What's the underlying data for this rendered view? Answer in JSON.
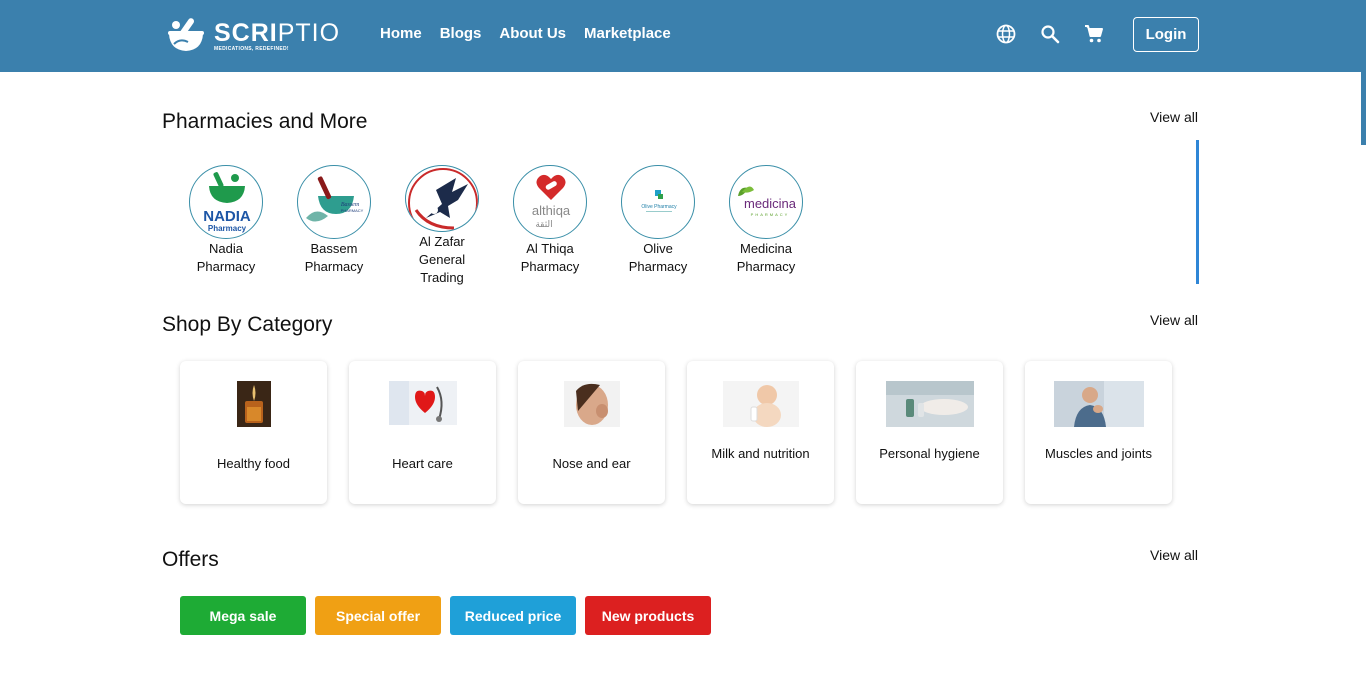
{
  "header": {
    "logo_name_bold": "SCRI",
    "logo_name_thin": "PTIO",
    "logo_tagline": "MEDICATIONS, REDEFINED!",
    "nav": [
      "Home",
      "Blogs",
      "About Us",
      "Marketplace"
    ],
    "login_label": "Login",
    "icons": [
      "globe-icon",
      "search-icon",
      "cart-icon"
    ]
  },
  "pharmacies": {
    "title": "Pharmacies and More",
    "view_all": "View all",
    "items": [
      {
        "name": "Nadia Pharmacy",
        "logo_text": "NADIA",
        "logo_sub": "Pharmacy"
      },
      {
        "name": "Bassem Pharmacy",
        "logo_text": "Bassem",
        "logo_sub": "PHARMACY"
      },
      {
        "name": "Al Zafar General Trading",
        "logo_text": "",
        "logo_sub": ""
      },
      {
        "name": "Al Thiqa Pharmacy",
        "logo_text": "althiqa",
        "logo_sub": "الثقة"
      },
      {
        "name": "Olive Pharmacy",
        "logo_text": "Olive Pharmacy",
        "logo_sub": ""
      },
      {
        "name": "Medicina Pharmacy",
        "logo_text": "medicina",
        "logo_sub": "PHARMACY"
      }
    ]
  },
  "categories": {
    "title": "Shop By Category",
    "view_all": "View all",
    "items": [
      {
        "label": "Healthy food"
      },
      {
        "label": "Heart care"
      },
      {
        "label": "Nose and ear"
      },
      {
        "label": "Milk and nutrition"
      },
      {
        "label": "Personal hygiene"
      },
      {
        "label": "Muscles and joints"
      }
    ]
  },
  "offers": {
    "title": "Offers",
    "view_all": "View all",
    "items": [
      {
        "label": "Mega sale",
        "color": "#1eab35"
      },
      {
        "label": "Special offer",
        "color": "#f0a014"
      },
      {
        "label": "Reduced price",
        "color": "#1fa0d8"
      },
      {
        "label": "New products",
        "color": "#dc2020"
      }
    ]
  },
  "colors": {
    "header_bg": "#3b80ad",
    "accent_scroll": "#2f86d6"
  }
}
